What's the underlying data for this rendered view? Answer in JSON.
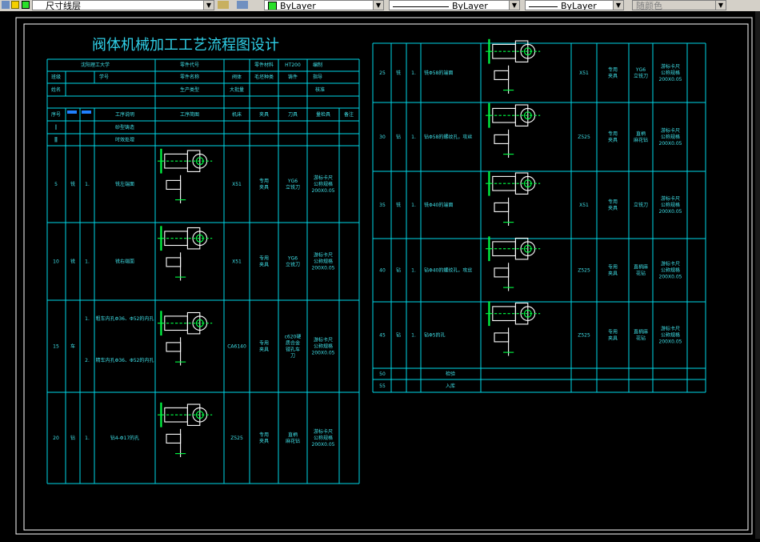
{
  "toolbar": {
    "layer_name": "尺寸线层",
    "color_value": "ByLayer",
    "linetype_value": "ByLayer",
    "lineweight_value": "ByLayer",
    "plotstyle_value": "随颜色"
  },
  "drawing": {
    "title": "阀体机械加工工艺流程图设计",
    "header": {
      "school": "沈阳理工大学",
      "part_code_label": "零件代号",
      "material_label": "零件材料",
      "material": "HT200",
      "prepared_label": "编制",
      "class_label": "班级",
      "student_no_label": "学号",
      "part_name_label": "零件名称",
      "part_name": "阀体",
      "blank_label": "毛坯种类",
      "blank": "铸件",
      "guide_label": "指导",
      "name_label": "姓名",
      "production_type_label": "生产类型",
      "production_type": "大批量",
      "check_label": "核准"
    },
    "columns": [
      "序号",
      "工序说明",
      "工序简图",
      "机床",
      "夹具",
      "刀具",
      "量检具",
      "备注"
    ],
    "pre_ops": [
      {
        "no": "Ⅰ",
        "desc": "砂型铸造"
      },
      {
        "no": "Ⅱ",
        "desc": "时效处理"
      }
    ],
    "left_ops": [
      {
        "no": "5",
        "type": "铣",
        "steps": [
          {
            "n": "1.",
            "text": "铣左端面"
          }
        ],
        "machine": "X51",
        "fixture": "专用\n夹具",
        "tool": "YG6\n立铣刀",
        "gauge": "游标卡尺\n公称规格\n200X0.05"
      },
      {
        "no": "10",
        "type": "铣",
        "steps": [
          {
            "n": "1.",
            "text": "铣右端面"
          }
        ],
        "machine": "X51",
        "fixture": "专用\n夹具",
        "tool": "YG6\n立铣刀",
        "gauge": "游标卡尺\n公称规格\n200X0.05"
      },
      {
        "no": "15",
        "type": "车",
        "steps": [
          {
            "n": "1.",
            "text": "粗车内孔Φ36、Φ52的内孔"
          },
          {
            "n": "2.",
            "text": "精车内孔Φ36、Φ52的内孔"
          }
        ],
        "machine": "CA6140",
        "fixture": "专用\n夹具",
        "tool": "c620硬\n质合金\n镗孔车\n刀",
        "gauge": "游标卡尺\n公称规格\n200X0.05"
      },
      {
        "no": "20",
        "type": "钻",
        "steps": [
          {
            "n": "1.",
            "text": "钻4-Φ17的孔"
          }
        ],
        "machine": "Z525",
        "fixture": "专用\n夹具",
        "tool": "直柄\n麻花钻",
        "gauge": "游标卡尺\n公称规格\n200X0.05"
      }
    ],
    "right_ops": [
      {
        "no": "25",
        "type": "铣",
        "steps": [
          {
            "n": "1.",
            "text": "铣Φ58的端面"
          }
        ],
        "machine": "X51",
        "fixture": "专用\n夹具",
        "tool": "YG6\n立铣刀",
        "gauge": "游标卡尺\n公称规格\n200X0.05"
      },
      {
        "no": "30",
        "type": "钻",
        "steps": [
          {
            "n": "1.",
            "text": "钻Φ58的螺纹孔，攻丝"
          }
        ],
        "machine": "Z525",
        "fixture": "专用\n夹具",
        "tool": "直柄\n麻花钻",
        "gauge": "游标卡尺\n公称规格\n200X0.05"
      },
      {
        "no": "35",
        "type": "铣",
        "steps": [
          {
            "n": "1.",
            "text": "铣Φ40的端面"
          }
        ],
        "machine": "X51",
        "fixture": "专用\n夹具",
        "tool": "立铣刀",
        "gauge": "游标卡尺\n公称规格\n200X0.05"
      },
      {
        "no": "40",
        "type": "钻",
        "steps": [
          {
            "n": "1.",
            "text": "钻Φ40的螺纹孔，攻丝"
          }
        ],
        "machine": "Z525",
        "fixture": "专用\n夹具",
        "tool": "直柄麻\n花钻",
        "gauge": "游标卡尺\n公称规格\n200X0.05"
      },
      {
        "no": "45",
        "type": "钻",
        "steps": [
          {
            "n": "1.",
            "text": "钻Φ5的孔"
          }
        ],
        "machine": "Z525",
        "fixture": "专用\n夹具",
        "tool": "直柄麻\n花钻",
        "gauge": "游标卡尺\n公称规格\n200X0.05"
      },
      {
        "no": "50",
        "type": "",
        "steps": [
          {
            "n": "",
            "text": "检验"
          }
        ],
        "machine": "",
        "fixture": "",
        "tool": "",
        "gauge": ""
      },
      {
        "no": "55",
        "type": "",
        "steps": [
          {
            "n": "",
            "text": "入库"
          }
        ],
        "machine": "",
        "fixture": "",
        "tool": "",
        "gauge": ""
      }
    ]
  },
  "colors": {
    "background": "#000000",
    "table_line": "#00d8e8",
    "title": "#2fd0e8",
    "text": "#3fe0e8",
    "sketch": "#ffffff",
    "sketch_accent": "#00ff44",
    "frame": "#ffffff"
  }
}
